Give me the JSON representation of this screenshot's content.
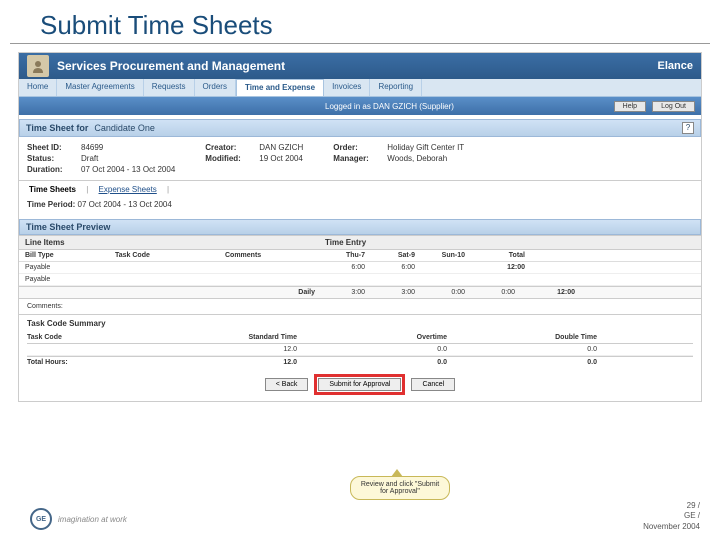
{
  "slide": {
    "title": "Submit Time Sheets"
  },
  "app": {
    "title": "Services Procurement and Management",
    "brand": "Elance"
  },
  "nav": {
    "tabs": [
      "Home",
      "Master Agreements",
      "Requests",
      "Orders",
      "Time and Expense",
      "Invoices",
      "Reporting"
    ],
    "active_index": 4
  },
  "userbar": {
    "login": "Logged in as DAN GZICH (Supplier)",
    "help": "Help",
    "logout": "Log Out"
  },
  "section": {
    "label": "Time Sheet for",
    "person": "Candidate One",
    "help_icon": "?"
  },
  "meta": {
    "sheet_id_lbl": "Sheet ID:",
    "sheet_id": "84699",
    "status_lbl": "Status:",
    "status": "Draft",
    "duration_lbl": "Duration:",
    "duration": "07 Oct 2004 - 13 Oct 2004",
    "creator_lbl": "Creator:",
    "creator": "DAN GZICH",
    "modified_lbl": "Modified:",
    "modified": "19 Oct 2004",
    "order_lbl": "Order:",
    "order": "Holiday Gift Center IT",
    "manager_lbl": "Manager:",
    "manager": "Woods, Deborah"
  },
  "subtabs": {
    "time": "Time Sheets",
    "expense": "Expense Sheets"
  },
  "period": {
    "lbl": "Time Period:",
    "val": "07 Oct 2004 - 13 Oct 2004"
  },
  "preview": {
    "title": "Time Sheet Preview"
  },
  "grid": {
    "lineitems_lbl": "Line Items",
    "timeentry_lbl": "Time Entry",
    "cols": {
      "type": "Bill Type",
      "task": "Task Code",
      "comments": "Comments",
      "thu7": "Thu-7",
      "sat9": "Sat-9",
      "sun10": "Sun-10",
      "total": "Total"
    },
    "rows": [
      {
        "type": "Payable",
        "task": "",
        "comments": "",
        "thu7": "6:00",
        "sat9": "6:00",
        "sun10": "",
        "total": "12:00"
      },
      {
        "type": "Payable",
        "task": "",
        "comments": "",
        "thu7": "",
        "sat9": "",
        "sun10": "",
        "total": ""
      }
    ],
    "daily": {
      "lbl": "Daily",
      "thu7": "3:00",
      "sat9": "3:00",
      "sun10": "0:00",
      "blank": "0:00",
      "total": "12:00"
    }
  },
  "comments": {
    "lbl": "Comments:"
  },
  "summary": {
    "title": "Task Code Summary",
    "cols": {
      "task": "Task Code",
      "std": "Standard Time",
      "ot": "Overtime",
      "dbl": "Double Time"
    },
    "rows": [
      {
        "task": "",
        "std": "12.0",
        "ot": "0.0",
        "dbl": "0.0"
      }
    ],
    "total": {
      "lbl": "Total Hours:",
      "std": "12.0",
      "ot": "0.0",
      "dbl": "0.0"
    }
  },
  "actions": {
    "back": "< Back",
    "submit": "Submit for Approval",
    "cancel": "Cancel"
  },
  "callout": {
    "text": "Review and click \"Submit for Approval\""
  },
  "footer": {
    "logo_text": "GE",
    "tagline": "imagination at work",
    "page": "29 /",
    "co": "GE /",
    "date": "November 2004"
  }
}
